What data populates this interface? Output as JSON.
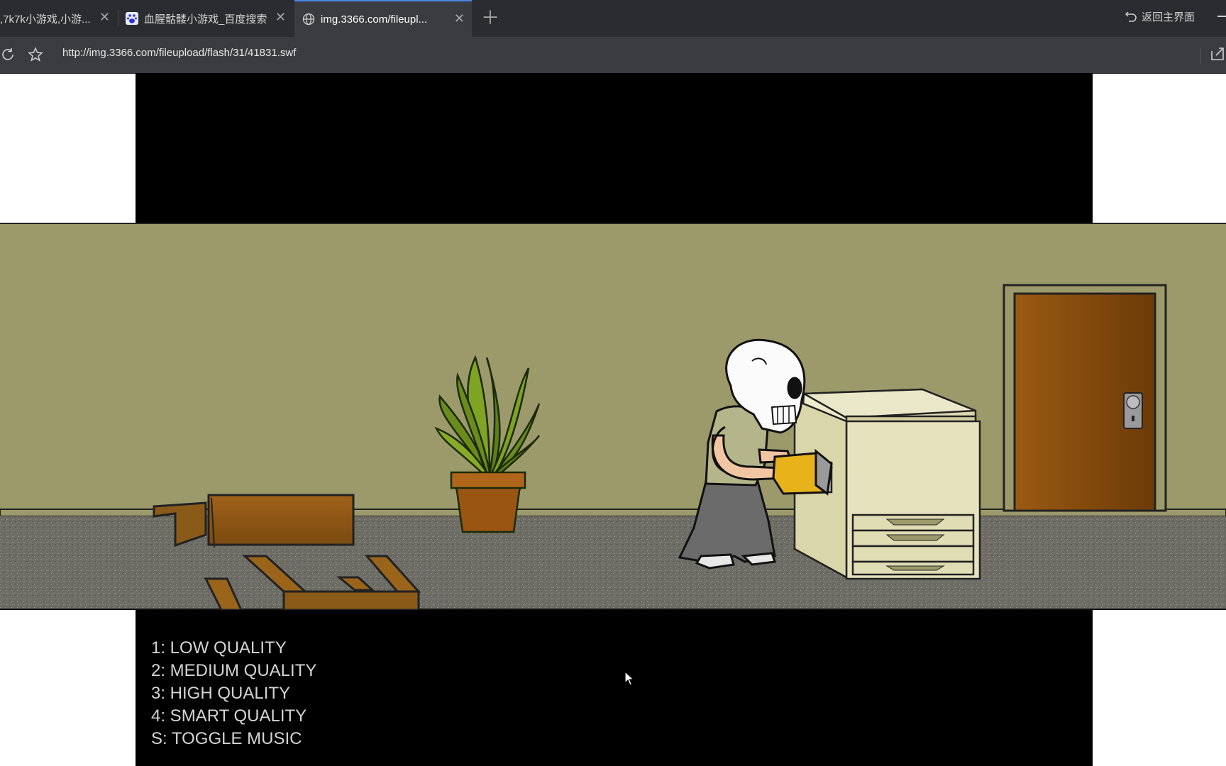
{
  "browser": {
    "tabs": [
      {
        "label": ",7k7k小游戏,小游...",
        "active": false
      },
      {
        "label": "血腥骷髅小游戏_百度搜索",
        "active": false
      },
      {
        "label": "img.3366.com/fileupl...",
        "active": true
      }
    ],
    "back_home_label": "返回主界面",
    "url": "http://img.3366.com/fileupload/flash/31/41831.swf"
  },
  "game": {
    "menu": [
      "1: LOW QUALITY",
      "2: MEDIUM QUALITY",
      "3: HIGH QUALITY",
      "4: SMART QUALITY",
      "S: TOGGLE MUSIC"
    ]
  },
  "colors": {
    "wall": "#9c9a6a",
    "floor": "#6f6e66",
    "door": "#8a4e11",
    "tab_accent": "#4a86e8"
  }
}
